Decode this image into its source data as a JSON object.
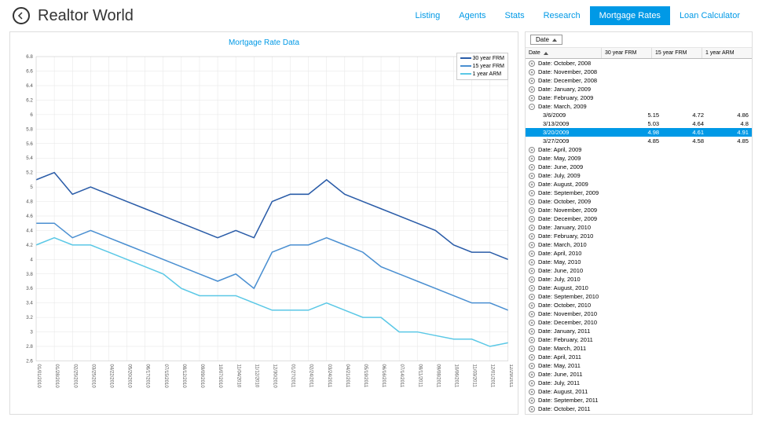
{
  "app_title": "Realtor World",
  "nav": [
    "Listing",
    "Agents",
    "Stats",
    "Research",
    "Mortgage Rates",
    "Loan Calculator"
  ],
  "nav_active": 4,
  "chart_title": "Mortgage Rate Data",
  "legend": [
    "30 year FRM",
    "15 year FRM",
    "1 year ARM"
  ],
  "colors": {
    "s30": "#2a5ca8",
    "s15": "#4a8fd1",
    "s1": "#5bc8e6"
  },
  "col_headers": {
    "date": "Date",
    "c30": "30 year FRM",
    "c15": "15 year FRM",
    "c1": "1 year ARM"
  },
  "groups": [
    {
      "label": "Date: October, 2008",
      "expanded": false
    },
    {
      "label": "Date: November, 2008",
      "expanded": false
    },
    {
      "label": "Date: December, 2008",
      "expanded": false
    },
    {
      "label": "Date: January, 2009",
      "expanded": false
    },
    {
      "label": "Date: February, 2009",
      "expanded": false
    },
    {
      "label": "Date: March, 2009",
      "expanded": true,
      "rows": [
        {
          "date": "3/6/2009",
          "c30": "5.15",
          "c15": "4.72",
          "c1": "4.86",
          "selected": false
        },
        {
          "date": "3/13/2009",
          "c30": "5.03",
          "c15": "4.64",
          "c1": "4.8",
          "selected": false
        },
        {
          "date": "3/20/2009",
          "c30": "4.98",
          "c15": "4.61",
          "c1": "4.91",
          "selected": true
        },
        {
          "date": "3/27/2009",
          "c30": "4.85",
          "c15": "4.58",
          "c1": "4.85",
          "selected": false
        }
      ]
    },
    {
      "label": "Date: April, 2009",
      "expanded": false
    },
    {
      "label": "Date: May, 2009",
      "expanded": false
    },
    {
      "label": "Date: June, 2009",
      "expanded": false
    },
    {
      "label": "Date: July, 2009",
      "expanded": false
    },
    {
      "label": "Date: August, 2009",
      "expanded": false
    },
    {
      "label": "Date: September, 2009",
      "expanded": false
    },
    {
      "label": "Date: October, 2009",
      "expanded": false
    },
    {
      "label": "Date: November, 2009",
      "expanded": false
    },
    {
      "label": "Date: December, 2009",
      "expanded": false
    },
    {
      "label": "Date: January, 2010",
      "expanded": false
    },
    {
      "label": "Date: February, 2010",
      "expanded": false
    },
    {
      "label": "Date: March, 2010",
      "expanded": false
    },
    {
      "label": "Date: April, 2010",
      "expanded": false
    },
    {
      "label": "Date: May, 2010",
      "expanded": false
    },
    {
      "label": "Date: June, 2010",
      "expanded": false
    },
    {
      "label": "Date: July, 2010",
      "expanded": false
    },
    {
      "label": "Date: August, 2010",
      "expanded": false
    },
    {
      "label": "Date: September, 2010",
      "expanded": false
    },
    {
      "label": "Date: October, 2010",
      "expanded": false
    },
    {
      "label": "Date: November, 2010",
      "expanded": false
    },
    {
      "label": "Date: December, 2010",
      "expanded": false
    },
    {
      "label": "Date: January, 2011",
      "expanded": false
    },
    {
      "label": "Date: February, 2011",
      "expanded": false
    },
    {
      "label": "Date: March, 2011",
      "expanded": false
    },
    {
      "label": "Date: April, 2011",
      "expanded": false
    },
    {
      "label": "Date: May, 2011",
      "expanded": false
    },
    {
      "label": "Date: June, 2011",
      "expanded": false
    },
    {
      "label": "Date: July, 2011",
      "expanded": false
    },
    {
      "label": "Date: August, 2011",
      "expanded": false
    },
    {
      "label": "Date: September, 2011",
      "expanded": false
    },
    {
      "label": "Date: October, 2011",
      "expanded": false
    }
  ],
  "chart_data": {
    "type": "line",
    "title": "Mortgage Rate Data",
    "xlabel": "",
    "ylabel": "",
    "ylim": [
      2.6,
      6.8
    ],
    "yticks": [
      2.6,
      2.8,
      3.0,
      3.2,
      3.4,
      3.6,
      3.8,
      4.0,
      4.2,
      4.4,
      4.6,
      4.8,
      5.0,
      5.2,
      5.4,
      5.6,
      5.8,
      6.0,
      6.2,
      6.4,
      6.6,
      6.8
    ],
    "x": [
      "01/01/2010",
      "01/28/2010",
      "02/25/2010",
      "03/25/2010",
      "04/22/2010",
      "05/20/2010",
      "06/17/2010",
      "07/15/2010",
      "08/12/2010",
      "09/09/2010",
      "10/07/2010",
      "11/04/2010",
      "11/12/2010",
      "12/30/2010",
      "01/27/2011",
      "02/24/2011",
      "03/24/2011",
      "04/21/2011",
      "05/19/2011",
      "06/16/2011",
      "07/14/2011",
      "08/11/2011",
      "09/08/2011",
      "10/06/2011",
      "11/03/2011",
      "12/01/2011",
      "12/29/2011"
    ],
    "series": [
      {
        "name": "30 year FRM",
        "values": [
          5.1,
          5.2,
          4.9,
          5.0,
          4.9,
          4.8,
          4.7,
          4.6,
          4.5,
          4.4,
          4.3,
          4.4,
          4.3,
          4.8,
          4.9,
          4.9,
          5.1,
          4.9,
          4.8,
          4.7,
          4.6,
          4.5,
          4.4,
          4.2,
          4.1,
          4.1,
          4.0
        ]
      },
      {
        "name": "15 year FRM",
        "values": [
          4.5,
          4.5,
          4.3,
          4.4,
          4.3,
          4.2,
          4.1,
          4.0,
          3.9,
          3.8,
          3.7,
          3.8,
          3.6,
          4.1,
          4.2,
          4.2,
          4.3,
          4.2,
          4.1,
          3.9,
          3.8,
          3.7,
          3.6,
          3.5,
          3.4,
          3.4,
          3.3
        ]
      },
      {
        "name": "1 year ARM",
        "values": [
          4.2,
          4.3,
          4.2,
          4.2,
          4.1,
          4.0,
          3.9,
          3.8,
          3.6,
          3.5,
          3.5,
          3.5,
          3.4,
          3.3,
          3.3,
          3.3,
          3.4,
          3.3,
          3.2,
          3.2,
          3.0,
          3.0,
          2.95,
          2.9,
          2.9,
          2.8,
          2.85
        ]
      }
    ]
  }
}
